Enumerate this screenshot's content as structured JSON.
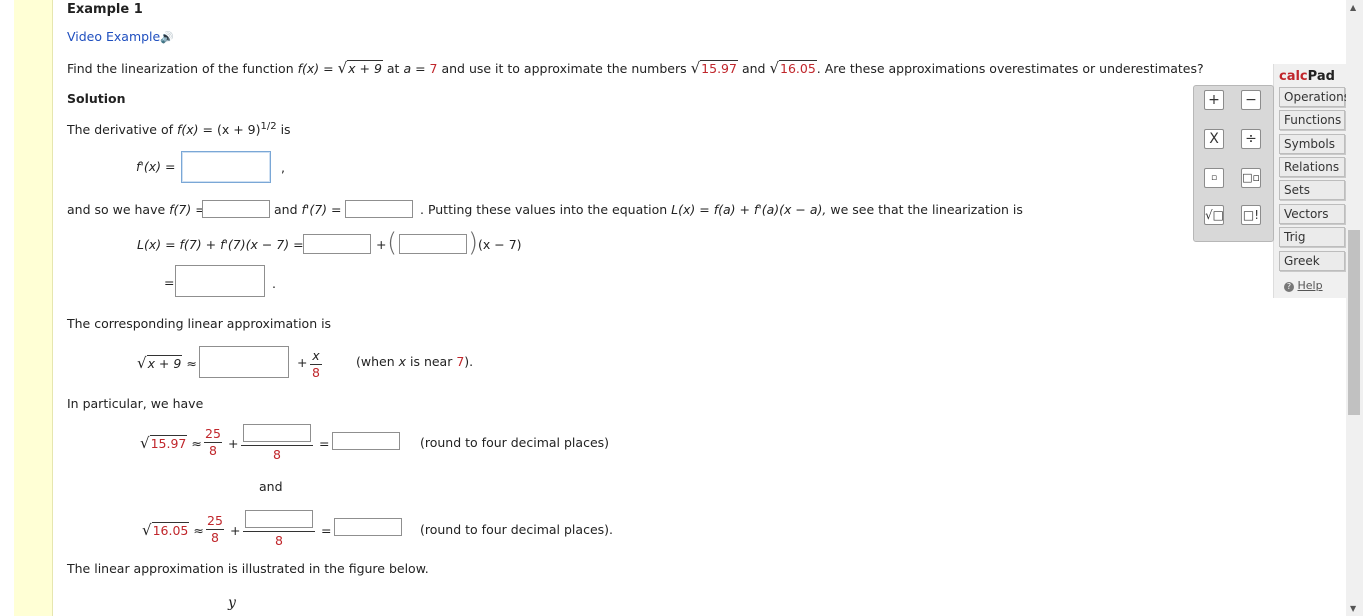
{
  "example_title": "Example 1",
  "video_link": "Video Example",
  "speaker_glyph": "🔊",
  "problem": {
    "p1": "Find the linearization of the function ",
    "fx": "f(x)",
    "eq": " = ",
    "radicand": "x + 9",
    "p2": " at ",
    "a_var": "a",
    "p3": " = ",
    "a_val": "7",
    "p4": " and use it to approximate the numbers ",
    "n1": "15.97",
    "p5": " and ",
    "n2": "16.05",
    "p6": ". Are these approximations overestimates or underestimates?"
  },
  "solution_heading": "Solution",
  "derivative": {
    "p1": "The derivative of ",
    "fx": "f(x)",
    "p2": " = (x + 9)",
    "exp": "1/2",
    "p3": " is"
  },
  "fprime_label": "f'(x)  =",
  "comma": ",",
  "andso": {
    "p1": "and so we have ",
    "f7": "f(7)",
    "eq": "  =",
    "p2": "and ",
    "fp7": "f'(7)",
    "eq2": "  =",
    "p3": ". Putting these values into the equation ",
    "eqn": "L(x) = f(a) + f'(a)(x − a),",
    "p4": " we see that the linearization is"
  },
  "lx_line": {
    "lhs": "L(x) = f(7) + f'(7)(x − 7)  =",
    "plus": "+",
    "tail": "(x − 7)"
  },
  "eq_sign": "=",
  "period": ".",
  "corresponding": "The corresponding linear approximation is",
  "approx_line": {
    "radicand": "x + 9",
    "approx": "≈",
    "plus": "+",
    "num": "x",
    "den": "8",
    "when_pre": "(when ",
    "when_x": "x",
    "when_mid": " is near ",
    "when_val": "7",
    "when_post": ")."
  },
  "in_particular": "In particular, we have",
  "approx1": {
    "radicand": "15.97",
    "approx": "≈",
    "num": "25",
    "den": "8",
    "plus": "+",
    "den2": "8",
    "eq": "=",
    "note": "(round to four decimal places)"
  },
  "and_word": "and",
  "approx2": {
    "radicand": "16.05",
    "approx": "≈",
    "num": "25",
    "den": "8",
    "plus": "+",
    "den2": "8",
    "eq": "=",
    "note": "(round to four decimal places)."
  },
  "illustrated": "The linear approximation is illustrated in the figure below.",
  "y_axis_label": "y",
  "calcpad": {
    "title_calc": "calc",
    "title_pad": "Pad",
    "tabs": [
      "Operations",
      "Functions",
      "Symbols",
      "Relations",
      "Sets",
      "Vectors",
      "Trig",
      "Greek"
    ],
    "help": "Help",
    "buttons": {
      "plus": "+",
      "minus": "−",
      "times": "X",
      "divide": "÷",
      "fraction": "▫",
      "power": "□▫",
      "sqrt": "√□",
      "factorial": "□!"
    }
  },
  "colors": {
    "red": "#c0262b",
    "link": "#1f4fbf",
    "side_band": "#ffffd5",
    "calcpad_title": "#c0262b"
  }
}
